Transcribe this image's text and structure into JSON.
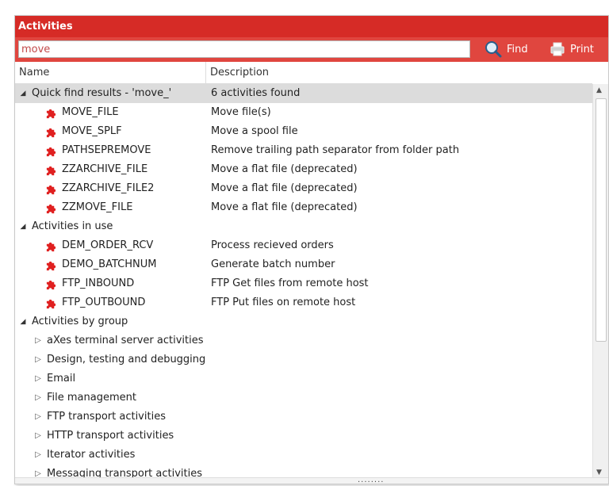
{
  "title": "Activities",
  "search": {
    "value": "move"
  },
  "toolbar": {
    "find_label": "Find",
    "print_label": "Print"
  },
  "columns": {
    "name": "Name",
    "description": "Description"
  },
  "groups": [
    {
      "label": "Quick find results - 'move_'",
      "description": "6 activities found",
      "items": [
        {
          "name": "MOVE_FILE",
          "description": "Move file(s)"
        },
        {
          "name": "MOVE_SPLF",
          "description": "Move a spool file"
        },
        {
          "name": "PATHSEPREMOVE",
          "description": "Remove trailing path separator from folder path"
        },
        {
          "name": "ZZARCHIVE_FILE",
          "description": "Move a flat file (deprecated)"
        },
        {
          "name": "ZZARCHIVE_FILE2",
          "description": "Move a flat file (deprecated)"
        },
        {
          "name": "ZZMOVE_FILE",
          "description": "Move a flat file (deprecated)"
        }
      ]
    },
    {
      "label": "Activities in use",
      "description": "",
      "items": [
        {
          "name": "DEM_ORDER_RCV",
          "description": "Process recieved orders"
        },
        {
          "name": "DEMO_BATCHNUM",
          "description": "Generate batch number"
        },
        {
          "name": "FTP_INBOUND",
          "description": "FTP Get files from remote host"
        },
        {
          "name": "FTP_OUTBOUND",
          "description": "FTP Put files on remote host"
        }
      ]
    },
    {
      "label": "Activities by group",
      "subgroups": [
        "aXes terminal server activities",
        "Design, testing and debugging",
        "Email",
        "File management",
        "FTP transport activities",
        "HTTP transport activities",
        "Iterator activities",
        "Messaging transport activities"
      ]
    }
  ],
  "icons": {
    "activity": "puzzle-piece-icon",
    "expanded": "expanded-triangle-icon",
    "collapsed": "collapsed-triangle-icon"
  },
  "colors": {
    "title_bg": "#d62b26",
    "toolbar_bg": "#e0463f",
    "puzzle": "#e02020",
    "selected_row": "#dcdcdc"
  },
  "grip": "........"
}
